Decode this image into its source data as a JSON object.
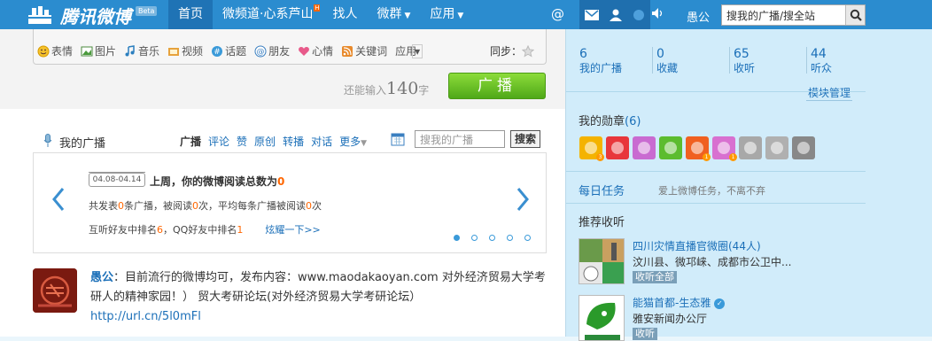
{
  "header": {
    "site_name": "腾讯微博",
    "beta": "Beta",
    "nav": [
      {
        "label": "首页",
        "active": true
      },
      {
        "label": "微频道·心系芦山",
        "badge": "H"
      },
      {
        "label": "找人"
      },
      {
        "label": "微群",
        "dropdown": true
      },
      {
        "label": "应用",
        "dropdown": true
      }
    ],
    "at_icon": "at-icon",
    "user_name": "愚公",
    "search_placeholder": "搜我的广播/搜全站"
  },
  "composer": {
    "tools": [
      {
        "icon": "smiley-icon",
        "label": "表情"
      },
      {
        "icon": "picture-icon",
        "label": "图片"
      },
      {
        "icon": "music-icon",
        "label": "音乐"
      },
      {
        "icon": "video-icon",
        "label": "视频"
      },
      {
        "icon": "hash-icon",
        "label": "话题"
      },
      {
        "icon": "at-icon",
        "label": "朋友"
      },
      {
        "icon": "heart-icon",
        "label": "心情"
      },
      {
        "icon": "rss-icon",
        "label": "关键词"
      }
    ],
    "app_label": "应用",
    "sync_label": "同步：",
    "remain_prefix": "还能输入",
    "remain_count": "140",
    "remain_suffix": "字",
    "post_button": "广播"
  },
  "feed": {
    "title": "我的广播",
    "tabs": [
      {
        "label": "广播",
        "active": true
      },
      {
        "label": "评论"
      },
      {
        "label": "赞"
      },
      {
        "label": "原创"
      },
      {
        "label": "转播"
      },
      {
        "label": "对话"
      },
      {
        "label": "更多",
        "dropdown": true
      }
    ],
    "search_placeholder": "搜我的广播",
    "search_button": "搜索"
  },
  "report": {
    "date_range": "04.08-04.14",
    "title_prefix": "上周，你的微博阅读总数为",
    "title_value": "0",
    "line1": {
      "a": "共发表",
      "b": "0",
      "c": "条广播，被阅读",
      "d": "0",
      "e": "次，平均每条广播被阅读",
      "f": "0",
      "g": "次"
    },
    "line2": {
      "a": "互听好友中排名",
      "b": "6",
      "c": "，QQ好友中排名",
      "d": "1"
    },
    "show_link": "炫耀一下>>",
    "page_count": 5,
    "current_page": 1
  },
  "post": {
    "author": "愚公",
    "colon": "：",
    "text": "目前流行的微博均可，发布内容：www.maodakaoyan.com 对外经济贸易大学考研人的精神家园！） 贸大考研论坛(对外经济贸易大学考研论坛）",
    "link": "http://url.cn/5l0mFl"
  },
  "sidebar": {
    "stats": [
      {
        "value": "6",
        "label": "我的广播"
      },
      {
        "value": "0",
        "label": "收藏"
      },
      {
        "value": "65",
        "label": "收听"
      },
      {
        "value": "44",
        "label": "听众"
      }
    ],
    "module_manage": "模块管理",
    "medals_title": "我的勋章",
    "medals_count": "(6)",
    "medals": [
      {
        "icon": "smile-medal-icon",
        "color": "#f4b300",
        "sub": "3"
      },
      {
        "icon": "star-medal-icon",
        "color": "#e8363b"
      },
      {
        "icon": "face-medal-icon",
        "color": "#c96bd1"
      },
      {
        "icon": "foot-medal-icon",
        "color": "#5cbc2e"
      },
      {
        "icon": "bell-medal-icon",
        "color": "#f06020",
        "sub": "1"
      },
      {
        "icon": "triangle-medal-icon",
        "color": "#d870d0",
        "sub": "1"
      },
      {
        "icon": "grey-medal-icon",
        "color": "#a8a8a8"
      },
      {
        "icon": "leaf-medal-icon",
        "color": "#b0b0b0"
      },
      {
        "icon": "book-medal-icon",
        "color": "#888888"
      }
    ],
    "daily_title": "每日任务",
    "daily_sub": "爱上微博任务，不离不弃",
    "recommend_title": "推荐收听",
    "recommend": [
      {
        "name": "四川灾情直播官微圈(44人)",
        "desc": "汶川县、微邛崃、成都市公卫中...",
        "button": "收听全部"
      },
      {
        "name": "能猫首都-生态雅",
        "desc": "雅安新闻办公厅",
        "button": "收听",
        "verified": true
      }
    ]
  }
}
